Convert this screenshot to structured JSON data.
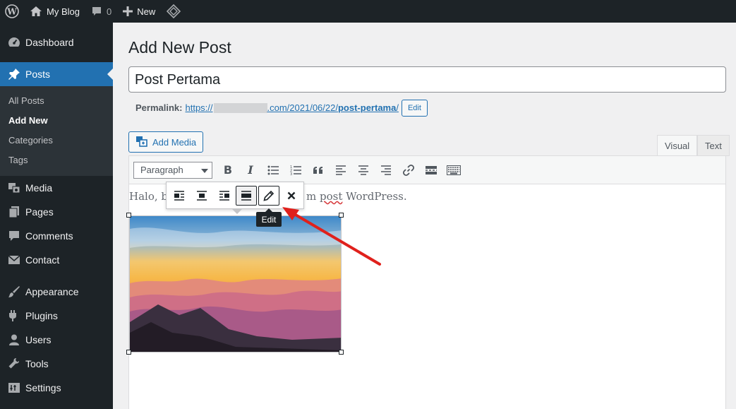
{
  "admin_bar": {
    "site_name": "My Blog",
    "comments_count": "0",
    "new_label": "New"
  },
  "sidebar": {
    "items": [
      {
        "label": "Dashboard",
        "icon": "dashboard-icon"
      },
      {
        "label": "Posts",
        "icon": "pin-icon",
        "active": true
      },
      {
        "label": "Media",
        "icon": "media-icon"
      },
      {
        "label": "Pages",
        "icon": "pages-icon"
      },
      {
        "label": "Comments",
        "icon": "comment-icon"
      },
      {
        "label": "Contact",
        "icon": "mail-icon"
      },
      {
        "label": "Appearance",
        "icon": "brush-icon"
      },
      {
        "label": "Plugins",
        "icon": "plugin-icon"
      },
      {
        "label": "Users",
        "icon": "user-icon"
      },
      {
        "label": "Tools",
        "icon": "wrench-icon"
      },
      {
        "label": "Settings",
        "icon": "settings-icon"
      }
    ],
    "submenu": [
      {
        "label": "All Posts"
      },
      {
        "label": "Add New",
        "current": true
      },
      {
        "label": "Categories"
      },
      {
        "label": "Tags"
      }
    ]
  },
  "main": {
    "page_title": "Add New Post",
    "post_title": "Post Pertama",
    "permalink": {
      "label": "Permalink:",
      "prefix": "https://",
      "middle": ".com/2021/06/22/",
      "slug": "post-pertama",
      "suffix": "/",
      "edit_label": "Edit"
    },
    "add_media_label": "Add Media",
    "tabs": {
      "visual": "Visual",
      "text": "Text"
    },
    "format_select": "Paragraph",
    "content": {
      "before": "Halo, b",
      "after": "m ",
      "misspelled": "post",
      "end": " WordPress."
    },
    "image_toolbar": {
      "tooltip": "Edit"
    }
  },
  "colors": {
    "accent": "#2271b1",
    "admin_dark": "#1d2327",
    "annotation_arrow": "#e0211c"
  }
}
